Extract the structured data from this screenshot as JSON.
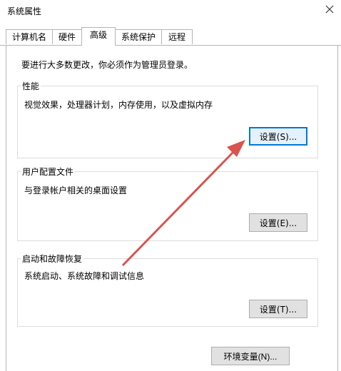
{
  "window": {
    "title": "系统属性",
    "close_icon": "close-icon"
  },
  "tabs": [
    {
      "label": "计算机名"
    },
    {
      "label": "硬件"
    },
    {
      "label": "高级",
      "active": true
    },
    {
      "label": "系统保护"
    },
    {
      "label": "远程"
    }
  ],
  "admin_note": "要进行大多数更改，你必须作为管理员登录。",
  "performance": {
    "title": "性能",
    "description": "视觉效果，处理器计划，内存使用，以及虚拟内存",
    "button_label": "设置(S)..."
  },
  "user_profiles": {
    "title": "用户配置文件",
    "description": "与登录帐户相关的桌面设置",
    "button_label": "设置(E)..."
  },
  "startup_recovery": {
    "title": "启动和故障恢复",
    "description": "系统启动、系统故障和调试信息",
    "button_label": "设置(T)..."
  },
  "env_button_label": "环境变量(N)...",
  "annotation_color": "#d9534f"
}
